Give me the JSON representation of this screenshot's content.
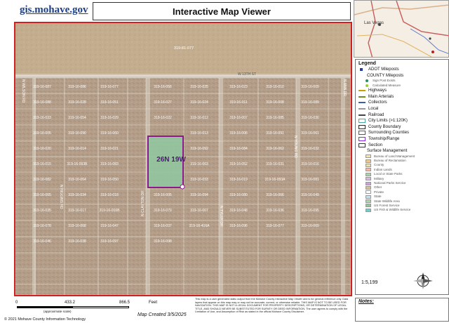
{
  "header": {
    "logo_text": "gis.mohave.gov",
    "title": "Interactive Map Viewer"
  },
  "inset": {
    "place_label": "Las Vegas"
  },
  "map": {
    "top_parcel": "319-81-077",
    "street_main": "W 13TH ST",
    "street_vertical_1": "N CLAYTON DR",
    "street_vertical_2": "N TYLER DR",
    "street_vertical_3": "N YOUNG RD",
    "street_vertical_4": "N HIGGINS RD",
    "street_far_right": "N ANN DR",
    "street_far_left": "N WILSON RD",
    "township_label": "26N 19W",
    "parcels": [
      "319-16-087",
      "319-16-086",
      "319-16-077",
      "319-16-056",
      "319-16-025",
      "319-16-023",
      "319-16-010",
      "319-16-009",
      "319-16-088",
      "319-16-028",
      "319-16-051",
      "319-16-027",
      "319-16-024",
      "319-16-011",
      "319-16-008",
      "319-16-089",
      "319-16-033",
      "319-16-054",
      "319-16-029",
      "319-16-022",
      "319-16-012",
      "319-16-007",
      "319-16-085",
      "319-16-030",
      "319-16-005",
      "319-16-090",
      "319-16-060",
      "319-16-013",
      "319-16-006",
      "319-16-091",
      "319-16-061",
      "319-16-020",
      "319-16-014",
      "319-16-021",
      "319-16-092",
      "319-16-084",
      "319-16-062",
      "319-16-032",
      "319-16-015",
      "319-16-093B",
      "319-16-083",
      "319-16-063",
      "319-16-052",
      "319-16-031",
      "319-16-016",
      "319-16-082",
      "319-16-064",
      "319-16-050",
      "319-16-033",
      "319-16-019",
      "319-16-093A",
      "319-16-081",
      "319-16-065",
      "319-16-034",
      "319-16-018",
      "319-16-005",
      "319-16-094",
      "319-16-080",
      "319-16-066",
      "319-16-049",
      "319-16-035",
      "319-16-017",
      "319-16-016B",
      "319-16-079",
      "319-16-067",
      "319-16-048",
      "319-16-036",
      "319-16-095",
      "319-16-078",
      "319-16-068",
      "319-16-047",
      "319-16-037",
      "319-16-416A",
      "319-16-096",
      "319-16-077",
      "319-16-069",
      "319-16-046",
      "319-16-038",
      "319-16-097",
      "319-16-098"
    ]
  },
  "legend": {
    "title": "Legend",
    "items": [
      {
        "label": "ADOT Mileposts",
        "type": "group",
        "color": "#1f3f9a"
      },
      {
        "label": "COUNTY Mileposts",
        "type": "group-plain"
      },
      {
        "label": "Sign Post Exists",
        "type": "small",
        "color": "#2e8b57"
      },
      {
        "label": "Calculated Measure",
        "type": "small",
        "color": "#9acd32"
      },
      {
        "label": "Highways",
        "type": "line",
        "color": "#c8a000"
      },
      {
        "label": "Main Arterials",
        "type": "line",
        "color": "#6b8e23"
      },
      {
        "label": "Collectors",
        "type": "line",
        "color": "#3e5fa8"
      },
      {
        "label": "Local",
        "type": "line",
        "color": "#999999"
      },
      {
        "label": "Railroad",
        "type": "line",
        "color": "#444444"
      },
      {
        "label": "City Limits (>1:120K)",
        "type": "box",
        "color": "#4aa4a4"
      },
      {
        "label": "County Boundary",
        "type": "box",
        "color": "#222222"
      },
      {
        "label": "Surrounding Counties",
        "type": "box",
        "color": "#555555"
      },
      {
        "label": "Township/Range",
        "type": "box",
        "color": "#8a2be2"
      },
      {
        "label": "Section",
        "type": "box",
        "color": "#333333"
      },
      {
        "label": "Surface Management",
        "type": "group-plain"
      },
      {
        "label": "Bureau of Land Management",
        "type": "fill-small",
        "color": "#f5e6a0"
      },
      {
        "label": "Bureau of Reclamation",
        "type": "fill-small",
        "color": "#f2c78f"
      },
      {
        "label": "County",
        "type": "fill-small",
        "color": "#e8e0b0"
      },
      {
        "label": "Indian Lands",
        "type": "fill-small",
        "color": "#f3b8a6"
      },
      {
        "label": "Local or State Parks",
        "type": "fill-small",
        "color": "#9fd79f"
      },
      {
        "label": "Military",
        "type": "fill-small",
        "color": "#d8b8e0"
      },
      {
        "label": "National Parks Service",
        "type": "fill-small",
        "color": "#c9a3d1"
      },
      {
        "label": "Other",
        "type": "fill-small",
        "color": "#d0c0a0"
      },
      {
        "label": "Private",
        "type": "fill-small",
        "color": "#ffffff"
      },
      {
        "label": "State",
        "type": "fill-small",
        "color": "#bfe3f5"
      },
      {
        "label": "State Wildlife Area",
        "type": "fill-small",
        "color": "#a8d8a8"
      },
      {
        "label": "US Forest Service",
        "type": "fill-small",
        "color": "#8fc98f"
      },
      {
        "label": "US Fish & Wildlife Service",
        "type": "fill-small",
        "color": "#7fc7c7"
      }
    ],
    "scale": "1:5,199"
  },
  "scalebar": {
    "labels": [
      "0",
      "433.2",
      "866.5",
      "Feet"
    ],
    "approx_label": "(approximate scale)"
  },
  "footer": {
    "map_created": "Map Created 3/5/2025",
    "copyright": "© 2021 Mohave County Information Technology",
    "disclaimer": "This map is a user generated static output from the Mohave County Interactive Map Viewer and is for general reference only. Data layers that appear on this map may or may not be accurate, current, or otherwise reliable. THIS MAP IS NOT TO BE USED FOR NAVIGATION. THIS MAP IS NOT A LEGAL DOCUMENT FOR PROPERTY DESCRIPTIONS, OR DETERMINATION OF LEGAL TITLE, AND SHOULD NEVER BE SUBSTITUTED FOR SURVEY OR DEED INFORMATION. The user agrees to comply with the Limitation of Use, and Assumption of Risk as stated in the official Mohave County Disclaimer.",
    "notes_label": "Notes:"
  },
  "colors": {
    "frame": "#d02020",
    "township": "#8b1a8b",
    "selected": "#8fc8a0",
    "lot_line": "#f0f0f0"
  }
}
